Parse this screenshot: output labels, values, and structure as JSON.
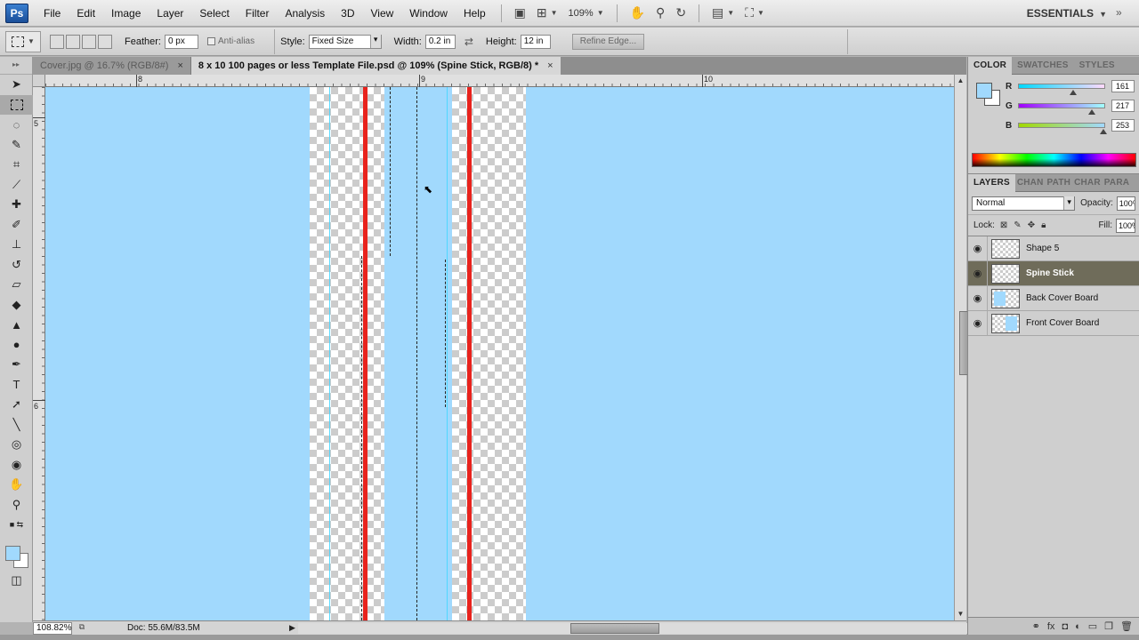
{
  "app": {
    "logo": "Ps"
  },
  "menu": [
    "File",
    "Edit",
    "Image",
    "Layer",
    "Select",
    "Filter",
    "Analysis",
    "3D",
    "View",
    "Window",
    "Help"
  ],
  "appbar": {
    "zoom": "109%",
    "workspace": "ESSENTIALS"
  },
  "options": {
    "feather_label": "Feather:",
    "feather_value": "0 px",
    "antialias_label": "Anti-alias",
    "style_label": "Style:",
    "style_value": "Fixed Size",
    "width_label": "Width:",
    "width_value": "0.2 in",
    "height_label": "Height:",
    "height_value": "12 in",
    "refine_edge_label": "Refine Edge..."
  },
  "tabs": [
    {
      "label": "Cover.jpg @ 16.7% (RGB/8#)",
      "close": "×",
      "active": false
    },
    {
      "label": "8 x 10 100 pages or less Template File.psd @ 109% (Spine Stick, RGB/8) *",
      "close": "×",
      "active": true
    }
  ],
  "rulers": {
    "h": [
      "8",
      "9",
      "10"
    ],
    "v": [
      "5",
      "6"
    ]
  },
  "status": {
    "zoom": "108.82%",
    "doc": "Doc: 55.6M/83.5M"
  },
  "color_panel": {
    "tabs": [
      "COLOR",
      "SWATCHES",
      "STYLES"
    ],
    "r_label": "R",
    "g_label": "G",
    "b_label": "B",
    "r": "161",
    "g": "217",
    "b": "253",
    "fill_levels": {
      "r": 0.631,
      "g": 0.851,
      "b": 0.992
    },
    "foreground": "#a1d9fd"
  },
  "layers_panel": {
    "tabs": [
      "LAYERS",
      "CHAN",
      "PATH",
      "CHAR",
      "PARA"
    ],
    "blend_mode": "Normal",
    "opacity_label": "Opacity:",
    "opacity": "100%",
    "lock_label": "Lock:",
    "fill_label": "Fill:",
    "fill": "100%",
    "layers": [
      {
        "name": "Shape 5",
        "selected": false
      },
      {
        "name": "Spine Stick",
        "selected": true
      },
      {
        "name": "Back Cover Board",
        "selected": false
      },
      {
        "name": "Front Cover Board",
        "selected": false
      }
    ]
  },
  "colors": {
    "canvas_blue": "#a1d9fd",
    "guide_red": "#e8231d",
    "selected_layer": "#6f6c5a"
  }
}
